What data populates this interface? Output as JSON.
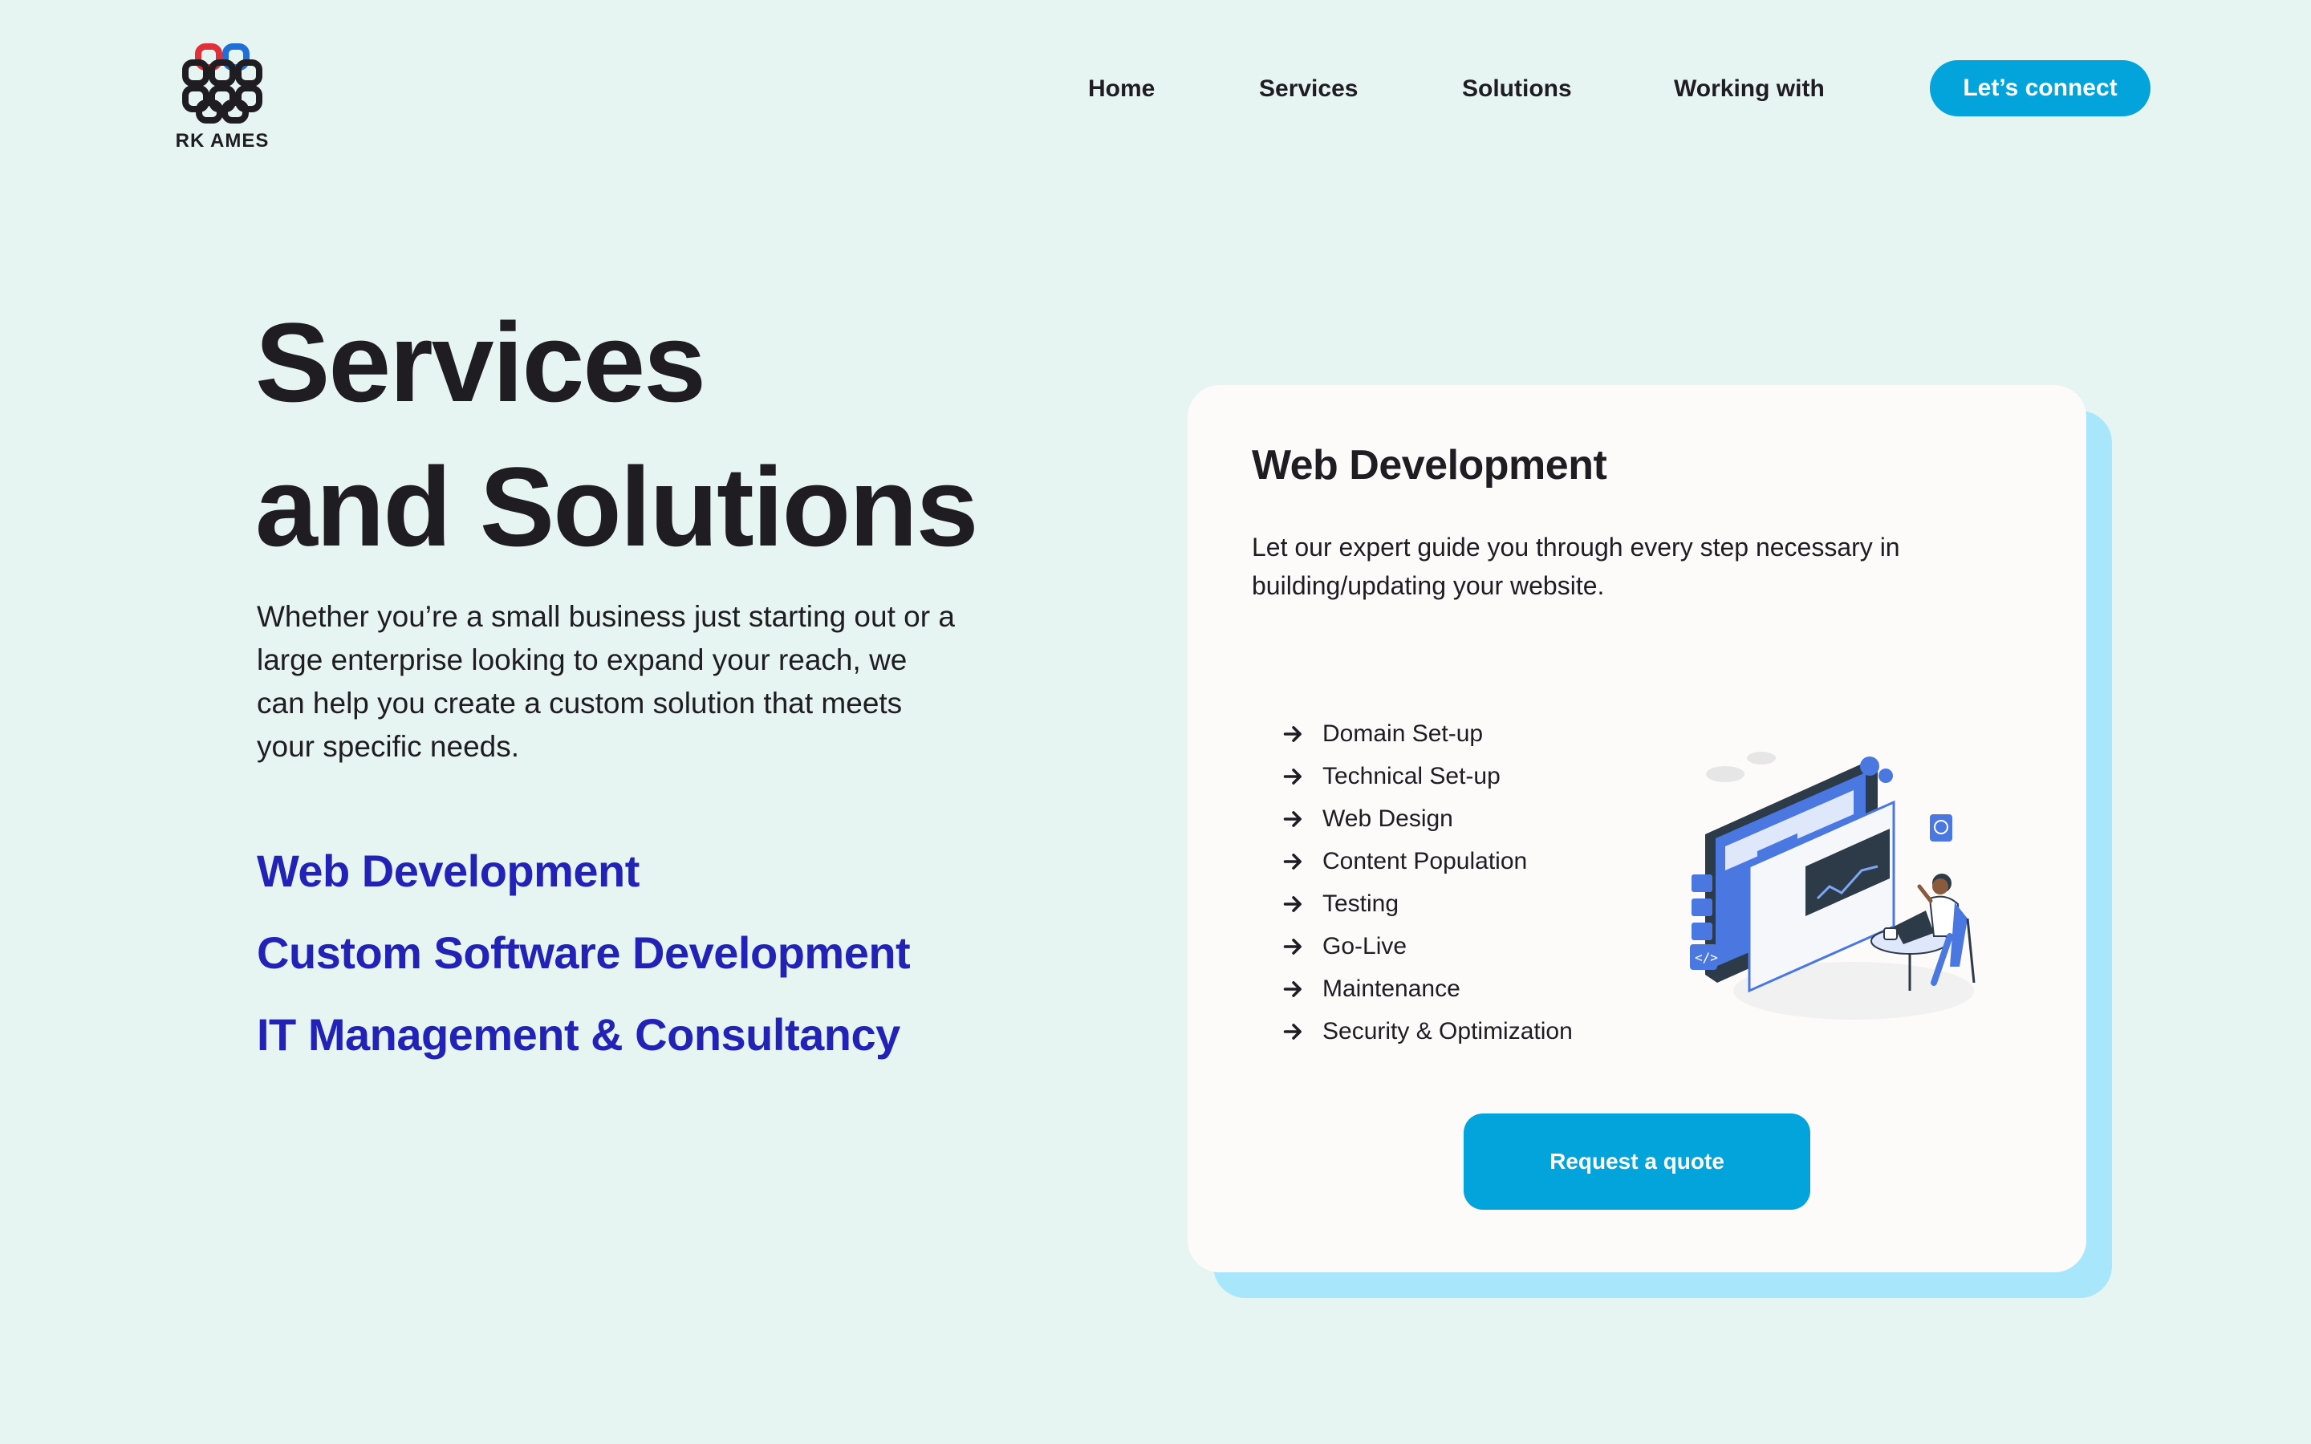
{
  "brand": {
    "name": "RK AMES",
    "colors": {
      "red": "#e0303a",
      "blue": "#1f6fd6",
      "dark": "#1f1c22"
    }
  },
  "nav": {
    "items": [
      "Home",
      "Services",
      "Solutions",
      "Working with"
    ],
    "cta": "Let’s connect"
  },
  "hero": {
    "title_line1": "Services",
    "title_line2": "and Solutions",
    "description": "Whether you’re a small business just starting out or a large enterprise looking to expand your reach, we can help you create a custom solution that meets your specific needs.",
    "services": [
      "Web Development",
      "Custom Software Development",
      "IT Management & Consultancy"
    ]
  },
  "card": {
    "title": "Web Development",
    "description": "Let our expert guide you through every step necessary in building/updating your website.",
    "features": [
      "Domain Set-up",
      "Technical Set-up",
      "Web Design",
      "Content Population",
      "Testing",
      "Go-Live",
      "Maintenance",
      "Security & Optimization"
    ],
    "illustration_icon": "web-developer-illustration",
    "cta": "Request a quote"
  },
  "colors": {
    "background": "#e6f5f1",
    "accent": "#03a4dc",
    "link": "#2322b7",
    "card": "#fdfafa",
    "card_shadow": "#a7e6fb"
  }
}
